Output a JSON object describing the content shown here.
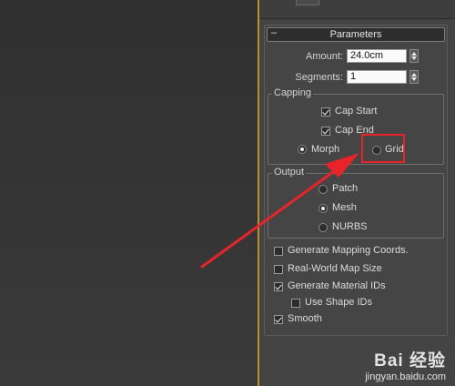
{
  "rollout": {
    "collapse_symbol": "–",
    "title": "Parameters"
  },
  "amount": {
    "label": "Amount:",
    "value": "24.0cm"
  },
  "segments": {
    "label": "Segments:",
    "value": "1"
  },
  "capping": {
    "title": "Capping",
    "cap_start": {
      "label": "Cap Start",
      "checked": true
    },
    "cap_end": {
      "label": "Cap End",
      "checked": true
    },
    "morph": {
      "label": "Morph",
      "selected": true
    },
    "grid": {
      "label": "Grid",
      "selected": false
    }
  },
  "output": {
    "title": "Output",
    "patch": {
      "label": "Patch",
      "selected": false
    },
    "mesh": {
      "label": "Mesh",
      "selected": true
    },
    "nurbs": {
      "label": "NURBS",
      "selected": false
    }
  },
  "options": [
    {
      "label": "Generate Mapping Coords.",
      "checked": false
    },
    {
      "label": "Real-World Map Size",
      "checked": false
    },
    {
      "label": "Generate Material IDs",
      "checked": true
    },
    {
      "label": "Use Shape IDs",
      "checked": false
    },
    {
      "label": "Smooth",
      "checked": true
    }
  ],
  "watermark": {
    "brand": "Bai 经验",
    "url": "jingyan.baidu.com"
  },
  "colors": {
    "highlight": "#e8232a",
    "viewport_border": "#b8912a",
    "panel_bg": "#444444"
  },
  "icons": {
    "collapse": "minus-icon",
    "spinner": "spinner-arrows-icon",
    "annotation": "red-arrow-icon"
  }
}
